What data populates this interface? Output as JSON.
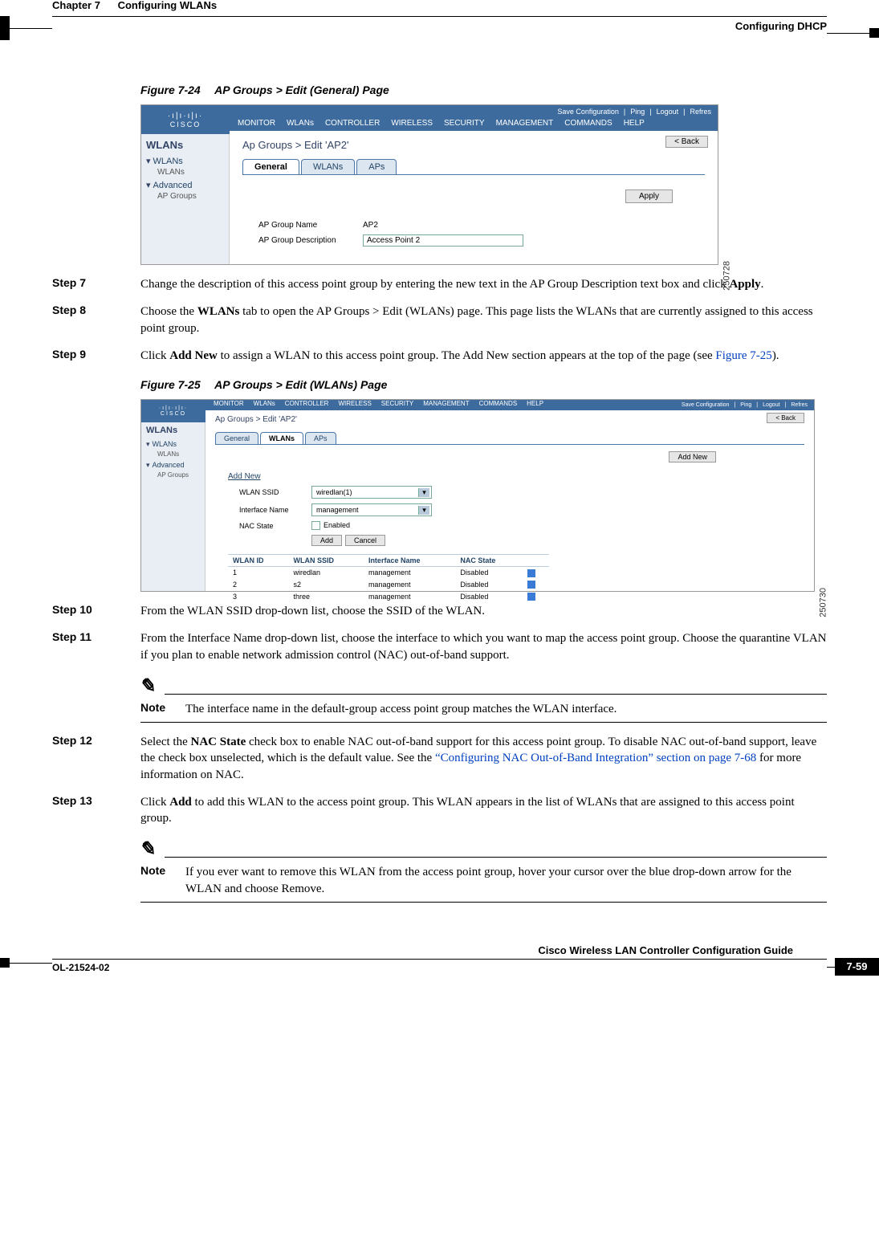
{
  "header": {
    "chapter": "Chapter 7",
    "title": "Configuring WLANs",
    "section": "Configuring DHCP"
  },
  "fig24": {
    "caption_no": "Figure 7-24",
    "caption_title": "AP Groups > Edit (General) Page",
    "refno": "250728",
    "logo": "CISCO",
    "toplinks": [
      "Save Configuration",
      "Ping",
      "Logout",
      "Refres"
    ],
    "menu": [
      "MONITOR",
      "WLANs",
      "CONTROLLER",
      "WIRELESS",
      "SECURITY",
      "MANAGEMENT",
      "COMMANDS",
      "HELP"
    ],
    "side_title": "WLANs",
    "side": [
      {
        "group": "WLANs",
        "items": [
          "WLANs"
        ]
      },
      {
        "group": "Advanced",
        "items": [
          "AP Groups"
        ]
      }
    ],
    "breadcrumb": "Ap Groups > Edit  'AP2'",
    "back": "< Back",
    "tabs": [
      "General",
      "WLANs",
      "APs"
    ],
    "active_tab": "General",
    "apply": "Apply",
    "rows": [
      {
        "label": "AP Group Name",
        "value": "AP2"
      },
      {
        "label": "AP Group Description",
        "value": "Access Point 2"
      }
    ]
  },
  "fig25": {
    "caption_no": "Figure 7-25",
    "caption_title": "AP Groups > Edit (WLANs) Page",
    "refno": "250730",
    "logo": "CISCO",
    "toplinks": [
      "Save Configuration",
      "Ping",
      "Logout",
      "Refres"
    ],
    "menu": [
      "MONITOR",
      "WLANs",
      "CONTROLLER",
      "WIRELESS",
      "SECURITY",
      "MANAGEMENT",
      "COMMANDS",
      "HELP"
    ],
    "side_title": "WLANs",
    "side": [
      {
        "group": "WLANs",
        "items": [
          "WLANs"
        ]
      },
      {
        "group": "Advanced",
        "items": [
          "AP Groups"
        ]
      }
    ],
    "breadcrumb": "Ap Groups > Edit  'AP2'",
    "back": "< Back",
    "tabs": [
      "General",
      "WLANs",
      "APs"
    ],
    "active_tab": "WLANs",
    "add_new_btn": "Add New",
    "add_new_h": "Add New",
    "form": {
      "ssid_label": "WLAN SSID",
      "ssid_value": "wiredlan(1)",
      "iface_label": "Interface Name",
      "iface_value": "management",
      "nac_label": "NAC State",
      "nac_chk": "Enabled",
      "add_btn": "Add",
      "cancel_btn": "Cancel"
    },
    "table": {
      "headers": [
        "WLAN ID",
        "WLAN SSID",
        "Interface Name",
        "NAC State"
      ],
      "rows": [
        [
          "1",
          "wiredlan",
          "management",
          "Disabled"
        ],
        [
          "2",
          "s2",
          "management",
          "Disabled"
        ],
        [
          "3",
          "three",
          "management",
          "Disabled"
        ]
      ]
    }
  },
  "steps": {
    "s7": {
      "label": "Step 7",
      "text_a": "Change the description of this access point group by entering the new text in the AP Group Description text box and click ",
      "bold_a": "Apply",
      "text_b": "."
    },
    "s8": {
      "label": "Step 8",
      "text_a": "Choose the ",
      "bold_a": "WLANs",
      "text_b": " tab to open the AP Groups > Edit (WLANs) page. This page lists the WLANs that are currently assigned to this access point group."
    },
    "s9": {
      "label": "Step 9",
      "text_a": "Click ",
      "bold_a": "Add New",
      "text_b": " to assign a WLAN to this access point group. The Add New section appears at the top of the page (see ",
      "link": "Figure 7-25",
      "text_c": ")."
    },
    "s10": {
      "label": "Step 10",
      "text": "From the WLAN SSID drop-down list, choose the SSID of the WLAN."
    },
    "s11": {
      "label": "Step 11",
      "text": "From the Interface Name drop-down list, choose the interface to which you want to map the access point group. Choose the quarantine VLAN if you plan to enable network admission control (NAC) out-of-band support."
    },
    "s12": {
      "label": "Step 12",
      "text_a": "Select the ",
      "bold_a": "NAC State",
      "text_b": " check box to enable NAC out-of-band support for this access point group. To disable NAC out-of-band support, leave the check box unselected, which is the default value. See the ",
      "link": "“Configuring NAC Out-of-Band Integration” section on page 7-68",
      "text_c": " for more information on NAC."
    },
    "s13": {
      "label": "Step 13",
      "text_a": "Click ",
      "bold_a": "Add",
      "text_b": " to add this WLAN to the access point group. This WLAN appears in the list of WLANs that are assigned to this access point group."
    }
  },
  "notes": {
    "n1": {
      "label": "Note",
      "text": "The interface name in the default-group access point group matches the WLAN interface."
    },
    "n2": {
      "label": "Note",
      "text_a": "If you ever want to remove this WLAN from the access point group, hover your cursor over the blue drop-down arrow for the WLAN and choose ",
      "bold": "Remove",
      "text_b": "."
    }
  },
  "footer": {
    "title": "Cisco Wireless LAN Controller Configuration Guide",
    "doc": "OL-21524-02",
    "page": "7-59"
  }
}
